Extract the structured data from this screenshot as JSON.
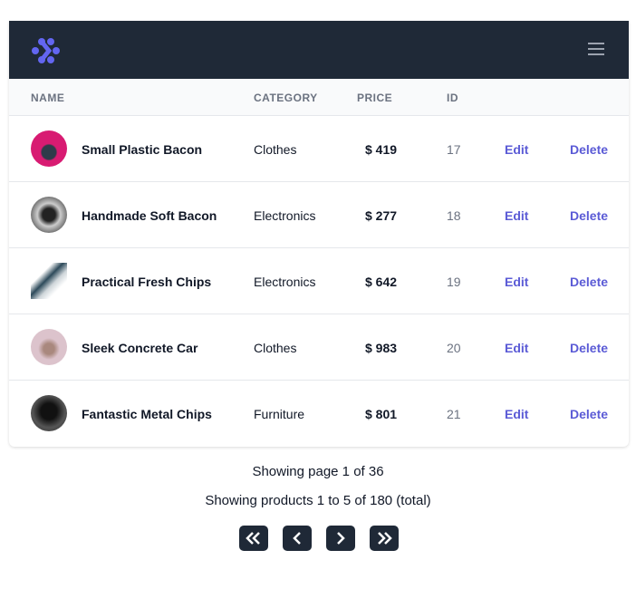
{
  "header": {
    "logo": "logo-icon",
    "menu": "hamburger-menu-icon"
  },
  "columns": {
    "name": "NAME",
    "category": "CATEGORY",
    "price": "PRICE",
    "id": "ID"
  },
  "products": [
    {
      "name": "Small Plastic Bacon",
      "category": "Clothes",
      "price": "$ 419",
      "id": "17",
      "edit": "Edit",
      "delete": "Delete"
    },
    {
      "name": "Handmade Soft Bacon",
      "category": "Electronics",
      "price": "$ 277",
      "id": "18",
      "edit": "Edit",
      "delete": "Delete"
    },
    {
      "name": "Practical Fresh Chips",
      "category": "Electronics",
      "price": "$ 642",
      "id": "19",
      "edit": "Edit",
      "delete": "Delete"
    },
    {
      "name": "Sleek Concrete Car",
      "category": "Clothes",
      "price": "$ 983",
      "id": "20",
      "edit": "Edit",
      "delete": "Delete"
    },
    {
      "name": "Fantastic Metal Chips",
      "category": "Furniture",
      "price": "$ 801",
      "id": "21",
      "edit": "Edit",
      "delete": "Delete"
    }
  ],
  "pagination": {
    "page_info": "Showing page 1 of 36",
    "products_info": "Showing products 1 to 5 of 180 (total)"
  },
  "colors": {
    "header": "#1f2937",
    "accent": "#5b5bd6"
  }
}
